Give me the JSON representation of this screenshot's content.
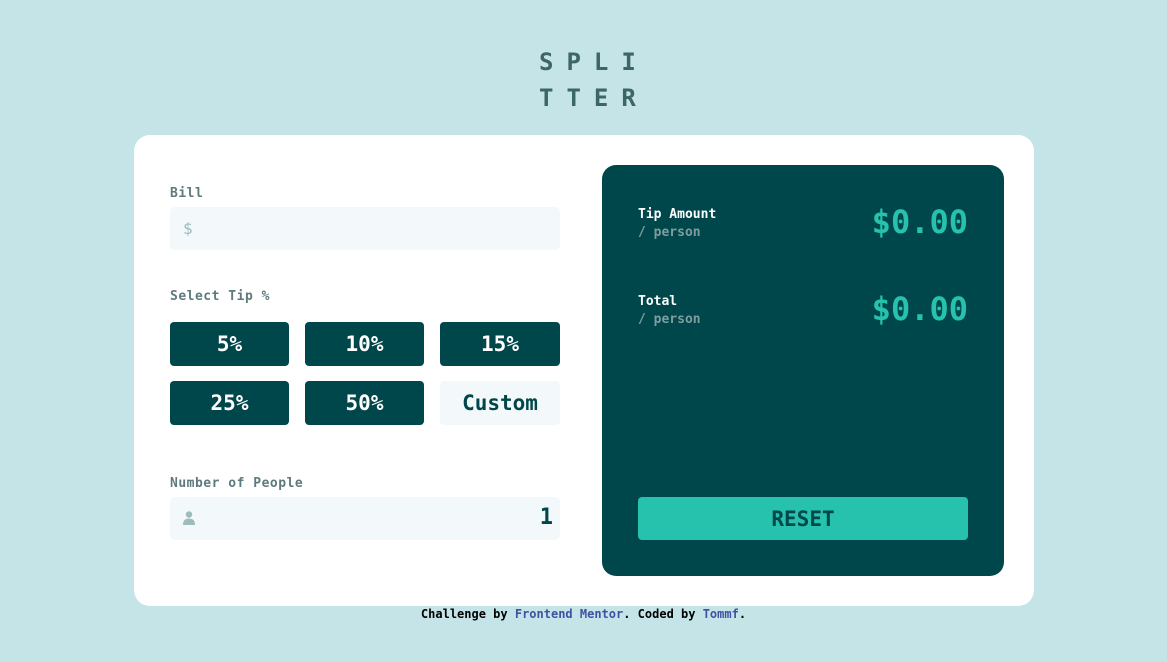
{
  "logo": {
    "line1": "SPLI",
    "line2": "TTER"
  },
  "form": {
    "bill_label": "Bill",
    "bill_currency_icon": "$",
    "bill_value": "",
    "tip_label": "Select Tip %",
    "tips": [
      "5%",
      "10%",
      "15%",
      "25%",
      "50%"
    ],
    "custom_label": "Custom",
    "people_label": "Number of People",
    "people_icon": "person-icon",
    "people_value": "1"
  },
  "results": {
    "tip_label": "Tip Amount",
    "tip_sub": "/ person",
    "tip_value": "$0.00",
    "total_label": "Total",
    "total_sub": "/ person",
    "total_value": "$0.00",
    "reset_label": "RESET"
  },
  "footer": {
    "prefix": "Challenge by ",
    "link1": "Frontend Mentor",
    "middle": ". Coded by ",
    "link2": "Tommf",
    "suffix": "."
  },
  "colors": {
    "background": "#c5e4e7",
    "dark_cyan": "#00474b",
    "strong_cyan": "#26c2ae",
    "input_bg": "#f3f9fa",
    "label": "#5e7a7d"
  }
}
